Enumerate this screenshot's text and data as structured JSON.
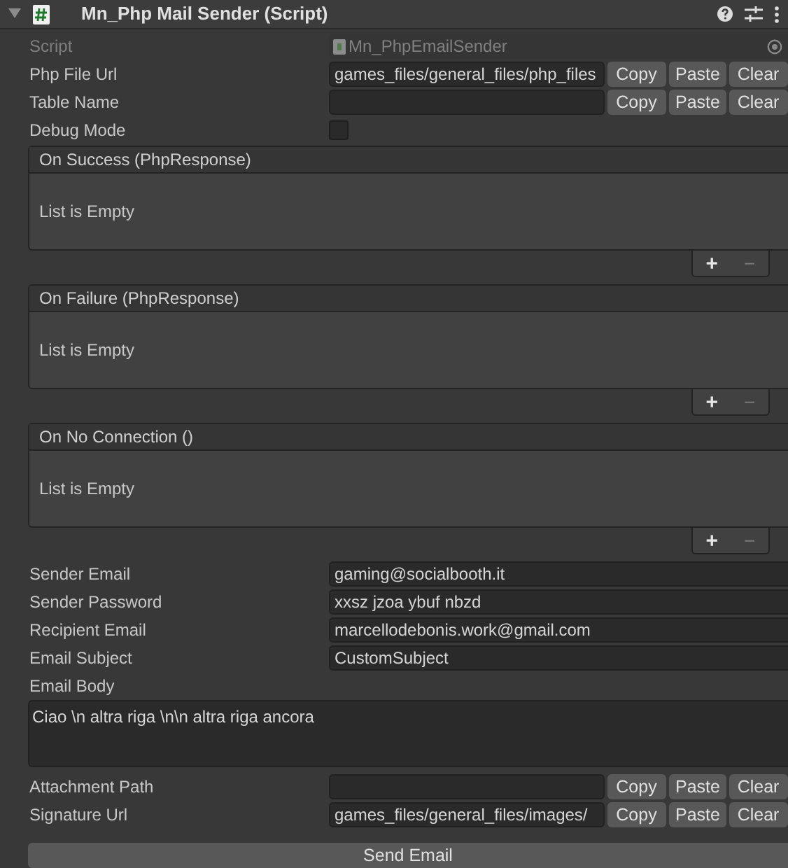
{
  "component": {
    "title": "Mn_Php Mail Sender (Script)",
    "expanded": true
  },
  "fields": [
    {
      "kind": "object",
      "label": "Script",
      "value": "Mn_PhpEmailSender",
      "disabled": true
    },
    {
      "kind": "text_buttons",
      "label": "Php File Url",
      "value": "games_files/general_files/php_files",
      "buttons": [
        "Copy",
        "Paste",
        "Clear"
      ],
      "disabled": false
    },
    {
      "kind": "text_buttons",
      "label": "Table Name",
      "buttons": [
        "Copy",
        "Paste",
        "Clear"
      ],
      "disabled": false
    },
    {
      "kind": "checkbox",
      "label": "Debug Mode",
      "checked": false,
      "disabled": false
    },
    {
      "kind": "event",
      "label": "On Success (PhpResponse)",
      "empty_text": "List is Empty",
      "add": "+",
      "remove": "−",
      "disabled": false
    },
    {
      "kind": "event",
      "label": "On Failure (PhpResponse)",
      "empty_text": "List is Empty",
      "add": "+",
      "remove": "−",
      "disabled": false
    },
    {
      "kind": "event",
      "label": "On No Connection ()",
      "empty_text": "List is Empty",
      "add": "+",
      "remove": "−",
      "disabled": false
    },
    {
      "kind": "text",
      "label": "Sender Email",
      "value": "gaming@socialbooth.it",
      "disabled": false
    },
    {
      "kind": "text",
      "label": "Sender Password",
      "value": "xxsz jzoa ybuf nbzd",
      "disabled": false
    },
    {
      "kind": "text",
      "label": "Recipient Email",
      "value": "marcellodebonis.work@gmail.com",
      "disabled": false
    },
    {
      "kind": "text",
      "label": "Email Subject",
      "value": "CustomSubject",
      "disabled": false
    },
    {
      "kind": "textarea",
      "label": "Email Body",
      "value": "Ciao \\n altra riga \\n\\n altra riga ancora",
      "disabled": false
    },
    {
      "kind": "text_buttons",
      "label": "Attachment Path",
      "buttons": [
        "Copy",
        "Paste",
        "Clear"
      ],
      "disabled": false
    },
    {
      "kind": "text_buttons",
      "label": "Signature Url",
      "value": "games_files/general_files/images/",
      "buttons": [
        "Copy",
        "Paste",
        "Clear"
      ],
      "disabled": false
    },
    {
      "kind": "button",
      "label": "Send Email",
      "disabled": false
    }
  ]
}
